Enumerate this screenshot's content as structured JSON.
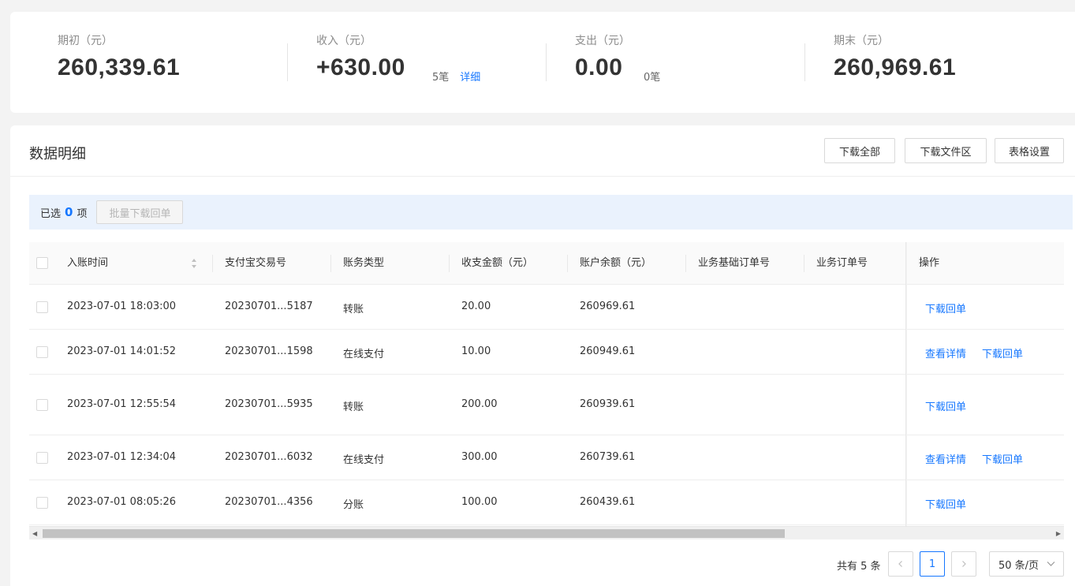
{
  "summary": {
    "opening": {
      "label": "期初（元）",
      "value": "260,339.61"
    },
    "income": {
      "label": "收入（元）",
      "value": "+630.00",
      "count": "5笔",
      "detail_link": "详细"
    },
    "expense": {
      "label": "支出（元）",
      "value": "0.00",
      "count": "0笔"
    },
    "closing": {
      "label": "期末（元）",
      "value": "260,969.61"
    }
  },
  "detail": {
    "title": "数据明细",
    "buttons": {
      "download_all": "下载全部",
      "download_files": "下载文件区",
      "table_settings": "表格设置"
    },
    "selection": {
      "prefix": "已选",
      "count": "0",
      "suffix": "项",
      "bulk_button": "批量下载回单"
    }
  },
  "table": {
    "columns": [
      "入账时间",
      "支付宝交易号",
      "账务类型",
      "收支金额（元）",
      "账户余额（元）",
      "业务基础订单号",
      "业务订单号",
      "操作"
    ],
    "rows": [
      {
        "time": "2023-07-01 18:03:00",
        "trade_no": "20230701...5187",
        "type": "转账",
        "amount": "20.00",
        "balance": "260969.61",
        "base_order": "",
        "order": "",
        "actions": [
          "下载回单"
        ]
      },
      {
        "time": "2023-07-01 14:01:52",
        "trade_no": "20230701...1598",
        "type": "在线支付",
        "amount": "10.00",
        "balance": "260949.61",
        "base_order": "",
        "order": "",
        "actions": [
          "查看详情",
          "下载回单"
        ]
      },
      {
        "time": "2023-07-01 12:55:54",
        "trade_no": "20230701...5935",
        "type": "转账",
        "amount": "200.00",
        "balance": "260939.61",
        "base_order": "",
        "order": "",
        "actions": [
          "下载回单"
        ]
      },
      {
        "time": "2023-07-01 12:34:04",
        "trade_no": "20230701...6032",
        "type": "在线支付",
        "amount": "300.00",
        "balance": "260739.61",
        "base_order": "",
        "order": "",
        "actions": [
          "查看详情",
          "下载回单"
        ]
      },
      {
        "time": "2023-07-01 08:05:26",
        "trade_no": "20230701...4356",
        "type": "分账",
        "amount": "100.00",
        "balance": "260439.61",
        "base_order": "",
        "order": "",
        "actions": [
          "下载回单"
        ]
      }
    ]
  },
  "pagination": {
    "total_text": "共有 5 条",
    "current_page": "1",
    "page_size": "50 条/页"
  },
  "colors": {
    "accent": "#1677ff",
    "selection_bg": "#eaf2fd"
  },
  "icons": {
    "sort": "sort-icon",
    "prev": "chevron-left-icon",
    "next": "chevron-right-icon",
    "dropdown": "chevron-down-icon"
  }
}
